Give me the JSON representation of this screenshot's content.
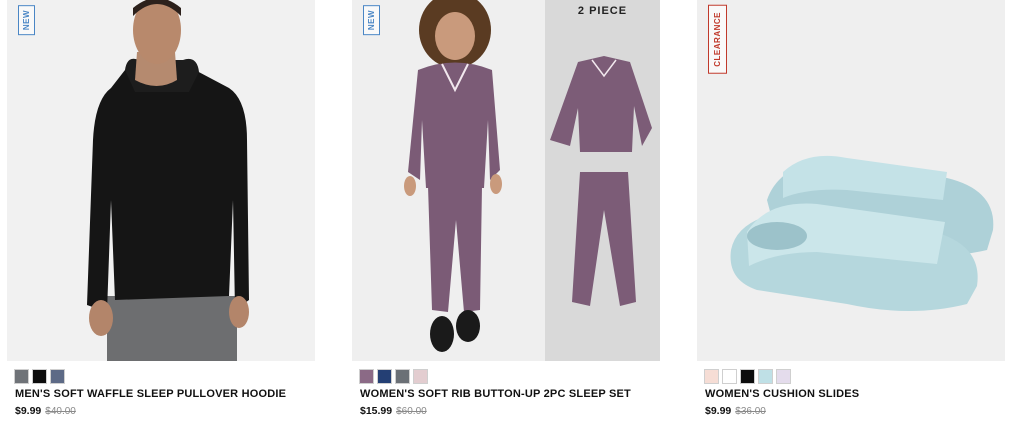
{
  "products": [
    {
      "badge": "NEW",
      "title": "MEN'S SOFT WAFFLE SLEEP PULLOVER HOODIE",
      "price": "$9.99",
      "was_price": "$40.00",
      "swatches": [
        "#6f7378",
        "#0d0d0d",
        "#5d6a86"
      ]
    },
    {
      "badge": "NEW",
      "overlay": "2 PIECE",
      "title": "WOMEN'S SOFT RIB BUTTON-UP 2PC SLEEP SET",
      "price": "$15.99",
      "was_price": "$60.00",
      "swatches": [
        "#8b6a86",
        "#243f74",
        "#6b7076",
        "#e3cdd0"
      ]
    },
    {
      "badge": "CLEARANCE",
      "title": "WOMEN'S CUSHION SLIDES",
      "price": "$9.99",
      "was_price": "$36.00",
      "swatches": [
        "#f6ddd5",
        "#ffffff",
        "#0d0d0d",
        "#bfe0e6",
        "#e4dcec"
      ]
    }
  ]
}
